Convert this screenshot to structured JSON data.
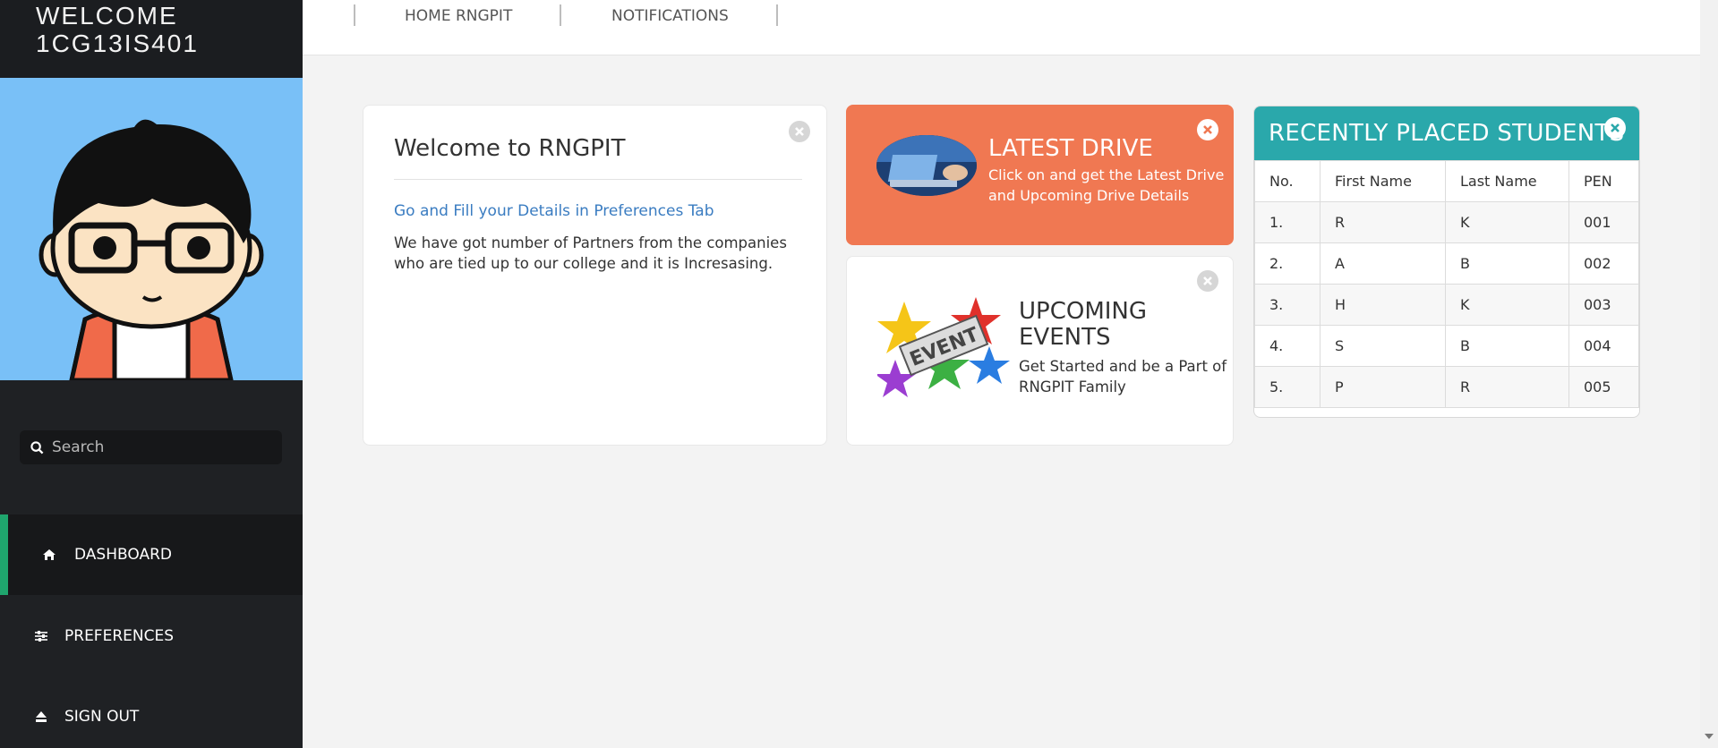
{
  "sidebar": {
    "welcome_line1": "WELCOME",
    "welcome_line2": "1CG13IS401",
    "search_placeholder": "Search",
    "nav": [
      {
        "label": "DASHBOARD",
        "icon": "home-icon",
        "active": true
      },
      {
        "label": "PREFERENCES",
        "icon": "sliders-icon",
        "active": false
      },
      {
        "label": "SIGN OUT",
        "icon": "eject-icon",
        "active": false
      }
    ]
  },
  "topnav": {
    "home": "HOME RNGPIT",
    "notifications": "NOTIFICATIONS"
  },
  "welcome_panel": {
    "title": "Welcome to RNGPIT",
    "link": "Go and Fill your Details in Preferences Tab",
    "text": "We have got number of Partners from the companies who are tied up to our college and it is Incresasing."
  },
  "drive_panel": {
    "title": "LATEST DRIVE",
    "text": "Click on and get the Latest Drive and Upcoming Drive Details"
  },
  "events_panel": {
    "title": "UPCOMING EVENTS",
    "text": "Get Started and be a Part of RNGPIT Family",
    "image_text": "EVENT"
  },
  "placed_panel": {
    "title": "RECENTLY PLACED STUDENTS",
    "columns": [
      "No.",
      "First Name",
      "Last Name",
      "PEN"
    ],
    "rows": [
      [
        "1.",
        "R",
        "K",
        "001"
      ],
      [
        "2.",
        "A",
        "B",
        "002"
      ],
      [
        "3.",
        "H",
        "K",
        "003"
      ],
      [
        "4.",
        "S",
        "B",
        "004"
      ],
      [
        "5.",
        "P",
        "R",
        "005"
      ]
    ]
  },
  "colors": {
    "sidebar_bg": "#1f2124",
    "active_accent": "#1fa56d",
    "drive_bg": "#f07852",
    "placed_header": "#2aa8ab",
    "link": "#3a7cc1",
    "avatar_bg": "#79c0f7"
  }
}
